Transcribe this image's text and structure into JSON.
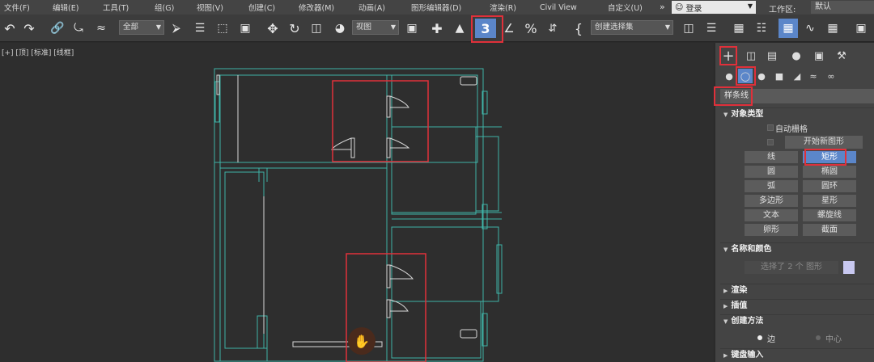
{
  "menu": [
    "文件(F)",
    "编辑(E)",
    "工具(T)",
    "组(G)",
    "视图(V)",
    "创建(C)",
    "修改器(M)",
    "动画(A)",
    "图形编辑器(D)",
    "渲染(R)",
    "Civil View",
    "自定义(U)"
  ],
  "menu_more": "»",
  "login_label": "登录",
  "workspace_label": "工作区:",
  "workspace_value": "默认",
  "toolbar": {
    "selection_filter": "全部",
    "ref_coord": "视图",
    "named_selection": "创建选择集",
    "snap_label": "3",
    "percent_label": "%",
    "brace_label": "{"
  },
  "viewport": {
    "label": "[+] [顶] [标准] [线框]"
  },
  "panel": {
    "category": "样条线",
    "section_object_type": "对象类型",
    "auto_grid": "自动栅格",
    "start_new_shape": "开始新图形",
    "buttons": [
      "线",
      "矩形",
      "圆",
      "椭圆",
      "弧",
      "圆环",
      "多边形",
      "星形",
      "文本",
      "螺旋线",
      "卵形",
      "截面"
    ],
    "active_button": "矩形",
    "section_name_color": "名称和颜色",
    "name_field": "选择了 2 个 图形",
    "section_render": "渲染",
    "section_interp": "插值",
    "section_create_method": "创建方法",
    "create_edge": "边",
    "create_center": "中心",
    "section_keyboard": "键盘输入",
    "accent_color": "#5b86c9",
    "highlight_color": "#e0303a"
  }
}
